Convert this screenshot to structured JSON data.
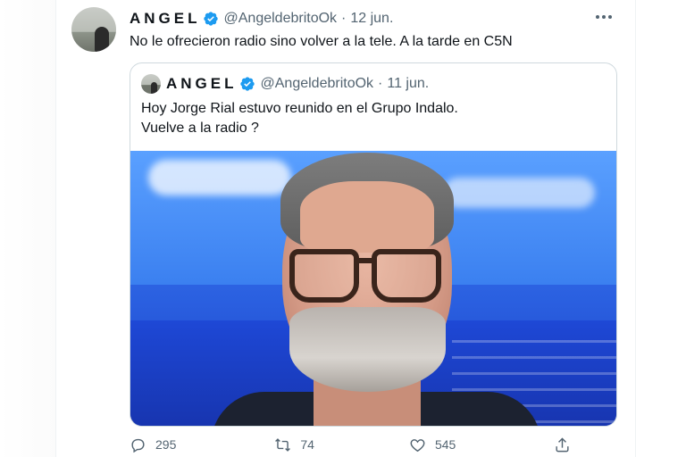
{
  "tweet": {
    "author_name": "ANGEL",
    "handle": "@AngeldebritoOk",
    "separator": "·",
    "date": "12 jun.",
    "more_icon": "more-horizontal-icon",
    "text": "No le ofrecieron radio sino volver a la tele. A la tarde en C5N"
  },
  "quoted": {
    "author_name": "ANGEL",
    "handle": "@AngeldebritoOk",
    "separator": "·",
    "date": "11 jun.",
    "text_line1": "Hoy Jorge Rial estuvo reunido en el Grupo Indalo.",
    "text_line2": "Vuelve a la radio ?"
  },
  "actions": {
    "replies": "295",
    "retweets": "74",
    "likes": "545",
    "icons": [
      "reply-icon",
      "retweet-icon",
      "like-icon",
      "share-icon"
    ]
  },
  "colors": {
    "text_primary": "#0f1419",
    "text_secondary": "#536471",
    "verified_blue": "#1d9bf0",
    "border": "#cfd9de"
  }
}
